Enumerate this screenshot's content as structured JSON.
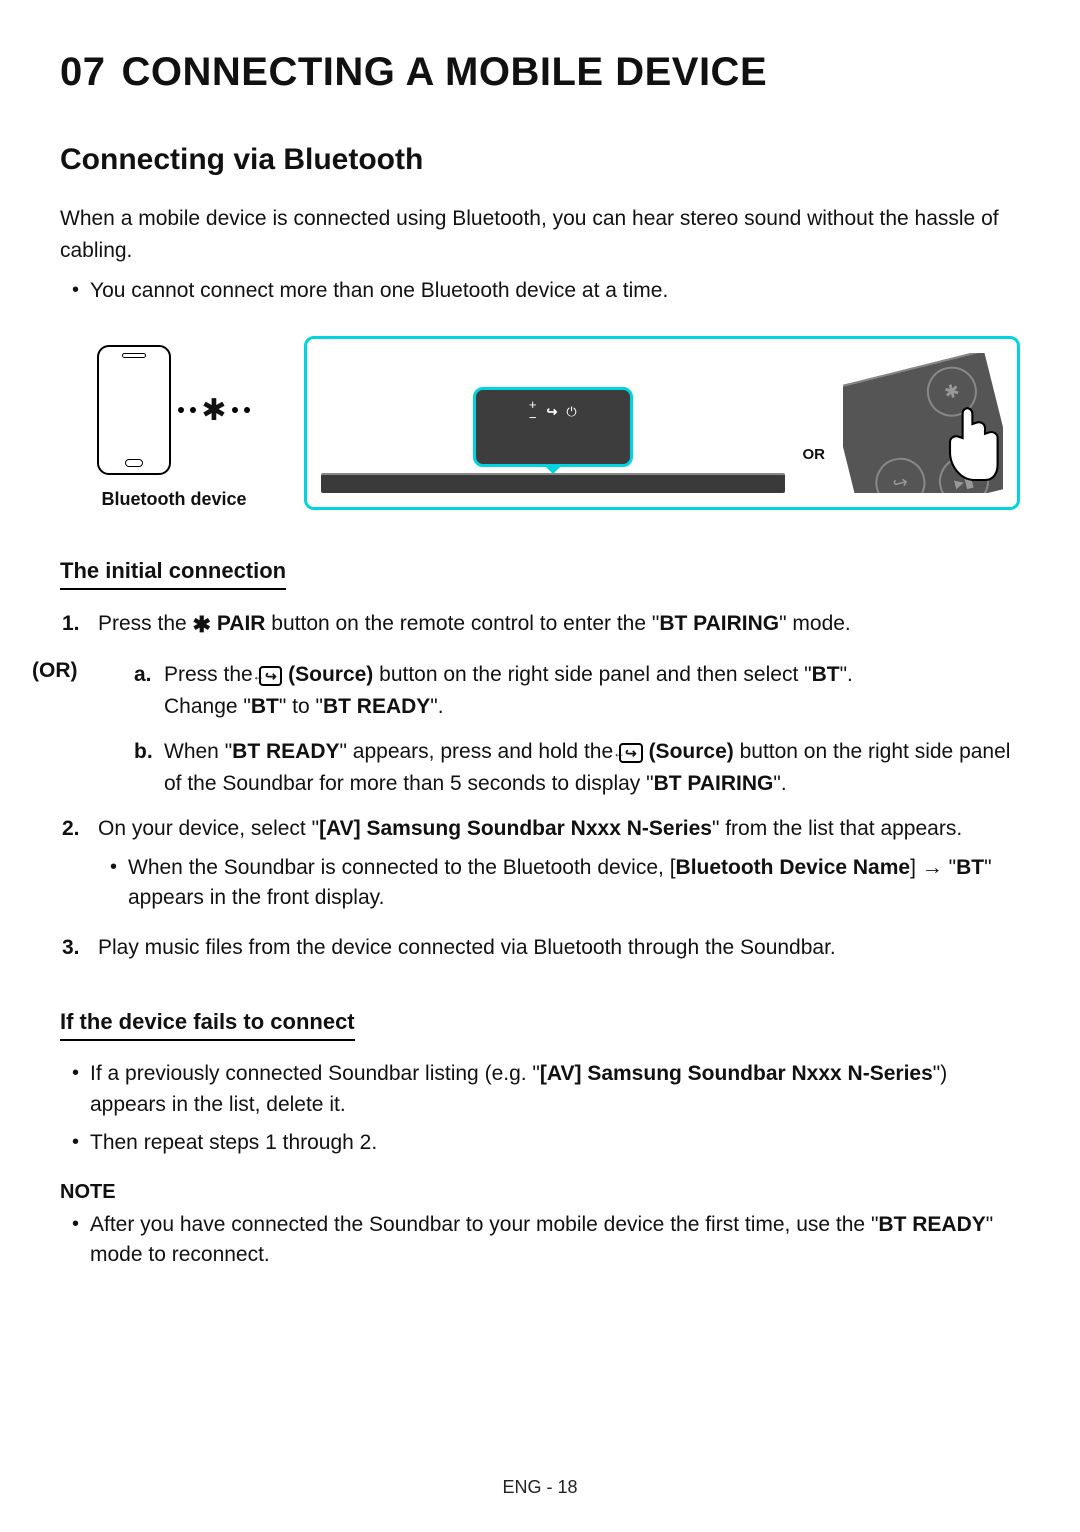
{
  "chapter": {
    "number": "07",
    "title": "CONNECTING A MOBILE DEVICE"
  },
  "section_title": "Connecting via Bluetooth",
  "intro": "When a mobile device is connected using Bluetooth, you can hear stereo sound without the hassle of cabling.",
  "intro_bullet": "You cannot connect more than one Bluetooth device at a time.",
  "figure": {
    "left_caption": "Bluetooth device",
    "or_label": "OR",
    "tv_icons": {
      "plus": "+",
      "source": "↪",
      "power": "⏻",
      "minus": "−"
    }
  },
  "subheading_initial": "The initial connection",
  "step1": {
    "num": "1.",
    "pre": "Press the ",
    "pair": "PAIR",
    "post1": " button on the remote control to enter the \"",
    "mode": "BT PAIRING",
    "post2": "\" mode."
  },
  "or_label": "(OR)",
  "step_a": {
    "num": "a.",
    "pre": "Press the ",
    "source": "(Source)",
    "post1": " button on the right side panel and then select \"",
    "bt": "BT",
    "post2": "\".",
    "line2_pre": "Change \"",
    "line2_bt": "BT",
    "line2_mid": "\" to \"",
    "line2_ready": "BT READY",
    "line2_post": "\"."
  },
  "step_b": {
    "num": "b.",
    "pre": "When \"",
    "ready": "BT READY",
    "mid1": "\" appears, press and hold the ",
    "source": "(Source)",
    "mid2": " button on the right side panel of the Soundbar for more than 5 seconds to display \"",
    "pairing": "BT PAIRING",
    "post": "\"."
  },
  "step2": {
    "num": "2.",
    "pre": "On your device, select \"",
    "device_name": "[AV] Samsung Soundbar Nxxx N-Series",
    "post": "\" from the list that appears.",
    "bullet_pre": "When the Soundbar is connected to the Bluetooth device, [",
    "bullet_dev": "Bluetooth Device Name",
    "bullet_arrow": "] → \"",
    "bullet_bt": "BT",
    "bullet_post": "\" appears in the front display."
  },
  "step3": {
    "num": "3.",
    "text": "Play music files from the device connected via Bluetooth through the Soundbar."
  },
  "subheading_fail": "If the device fails to connect",
  "fail_bullet1_pre": "If a previously connected Soundbar listing (e.g. \"",
  "fail_bullet1_name": "[AV] Samsung Soundbar Nxxx N-Series",
  "fail_bullet1_post": "\") appears in the list, delete it.",
  "fail_bullet2": "Then repeat steps 1 through 2.",
  "note_label": "NOTE",
  "note_bullet_pre": "After you have connected the Soundbar to your mobile device the first time, use the \"",
  "note_bullet_ready": "BT READY",
  "note_bullet_post": "\" mode to reconnect.",
  "footer": "ENG - 18"
}
